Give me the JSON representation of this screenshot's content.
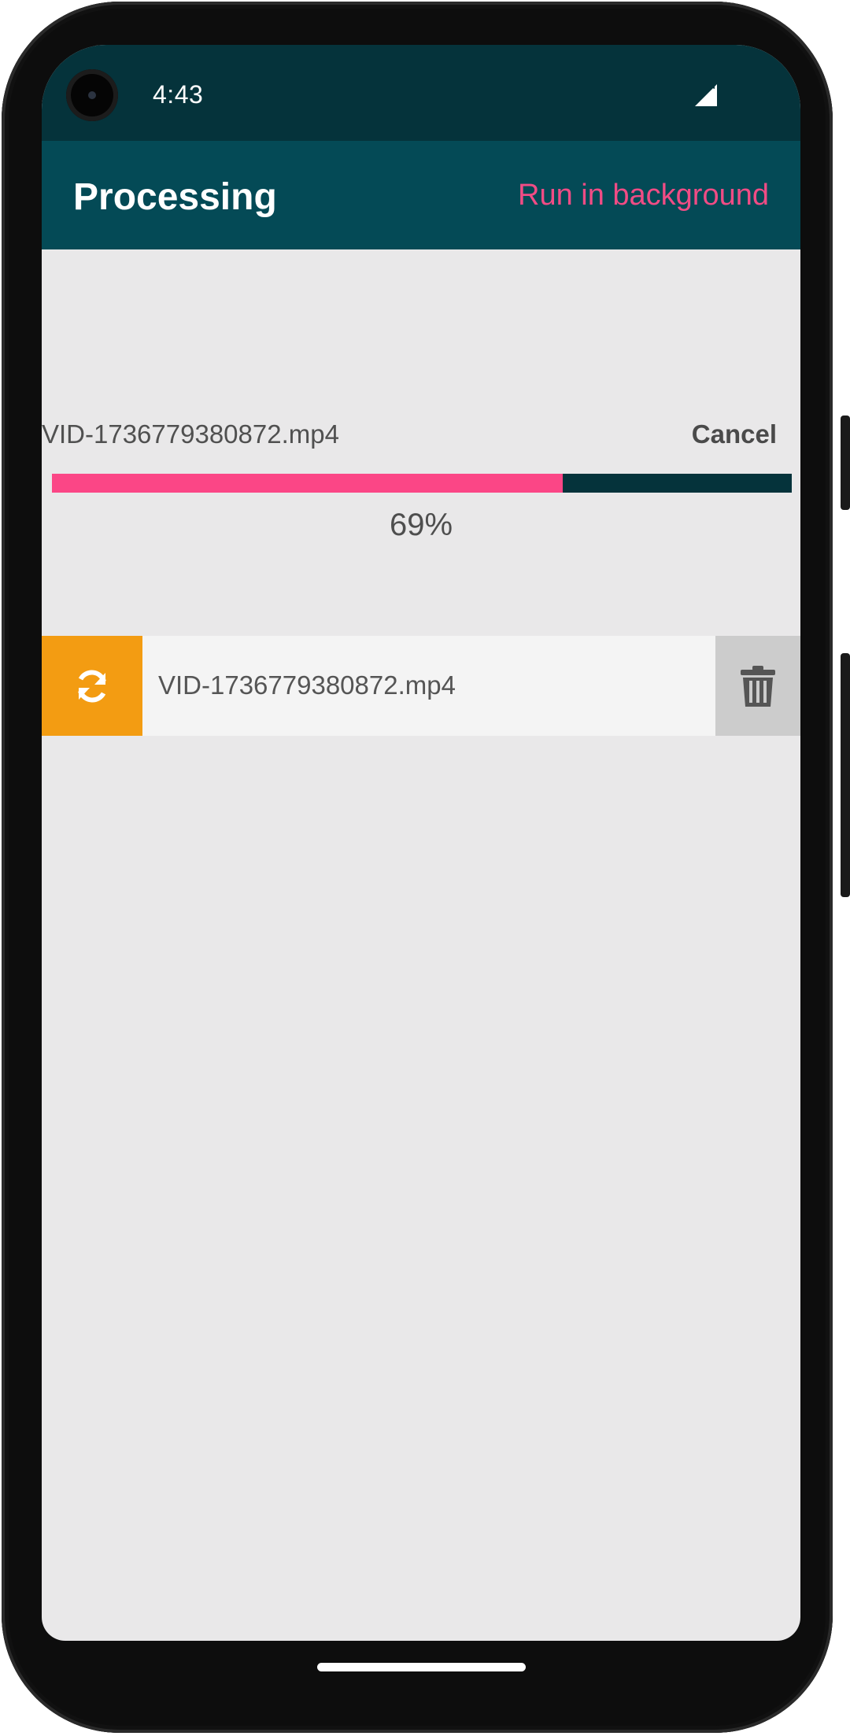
{
  "status_bar": {
    "time": "4:43",
    "signal_icon": "cellular-signal-icon",
    "background": "#05333b"
  },
  "app_bar": {
    "title": "Processing",
    "action_label": "Run in background",
    "background": "#044a56",
    "action_color": "#f04c85"
  },
  "current_task": {
    "file_name": "VID-1736779380872.mp4",
    "cancel_label": "Cancel",
    "progress": 0.69,
    "progress_text": "69%",
    "progress_color": "#fb4686",
    "track_color": "#05333b"
  },
  "queue": {
    "items": [
      {
        "name": "VID-1736779380872.mp4",
        "status_icon": "sync-icon",
        "status_color": "#f39c12",
        "action_icon": "trash-icon"
      }
    ]
  }
}
